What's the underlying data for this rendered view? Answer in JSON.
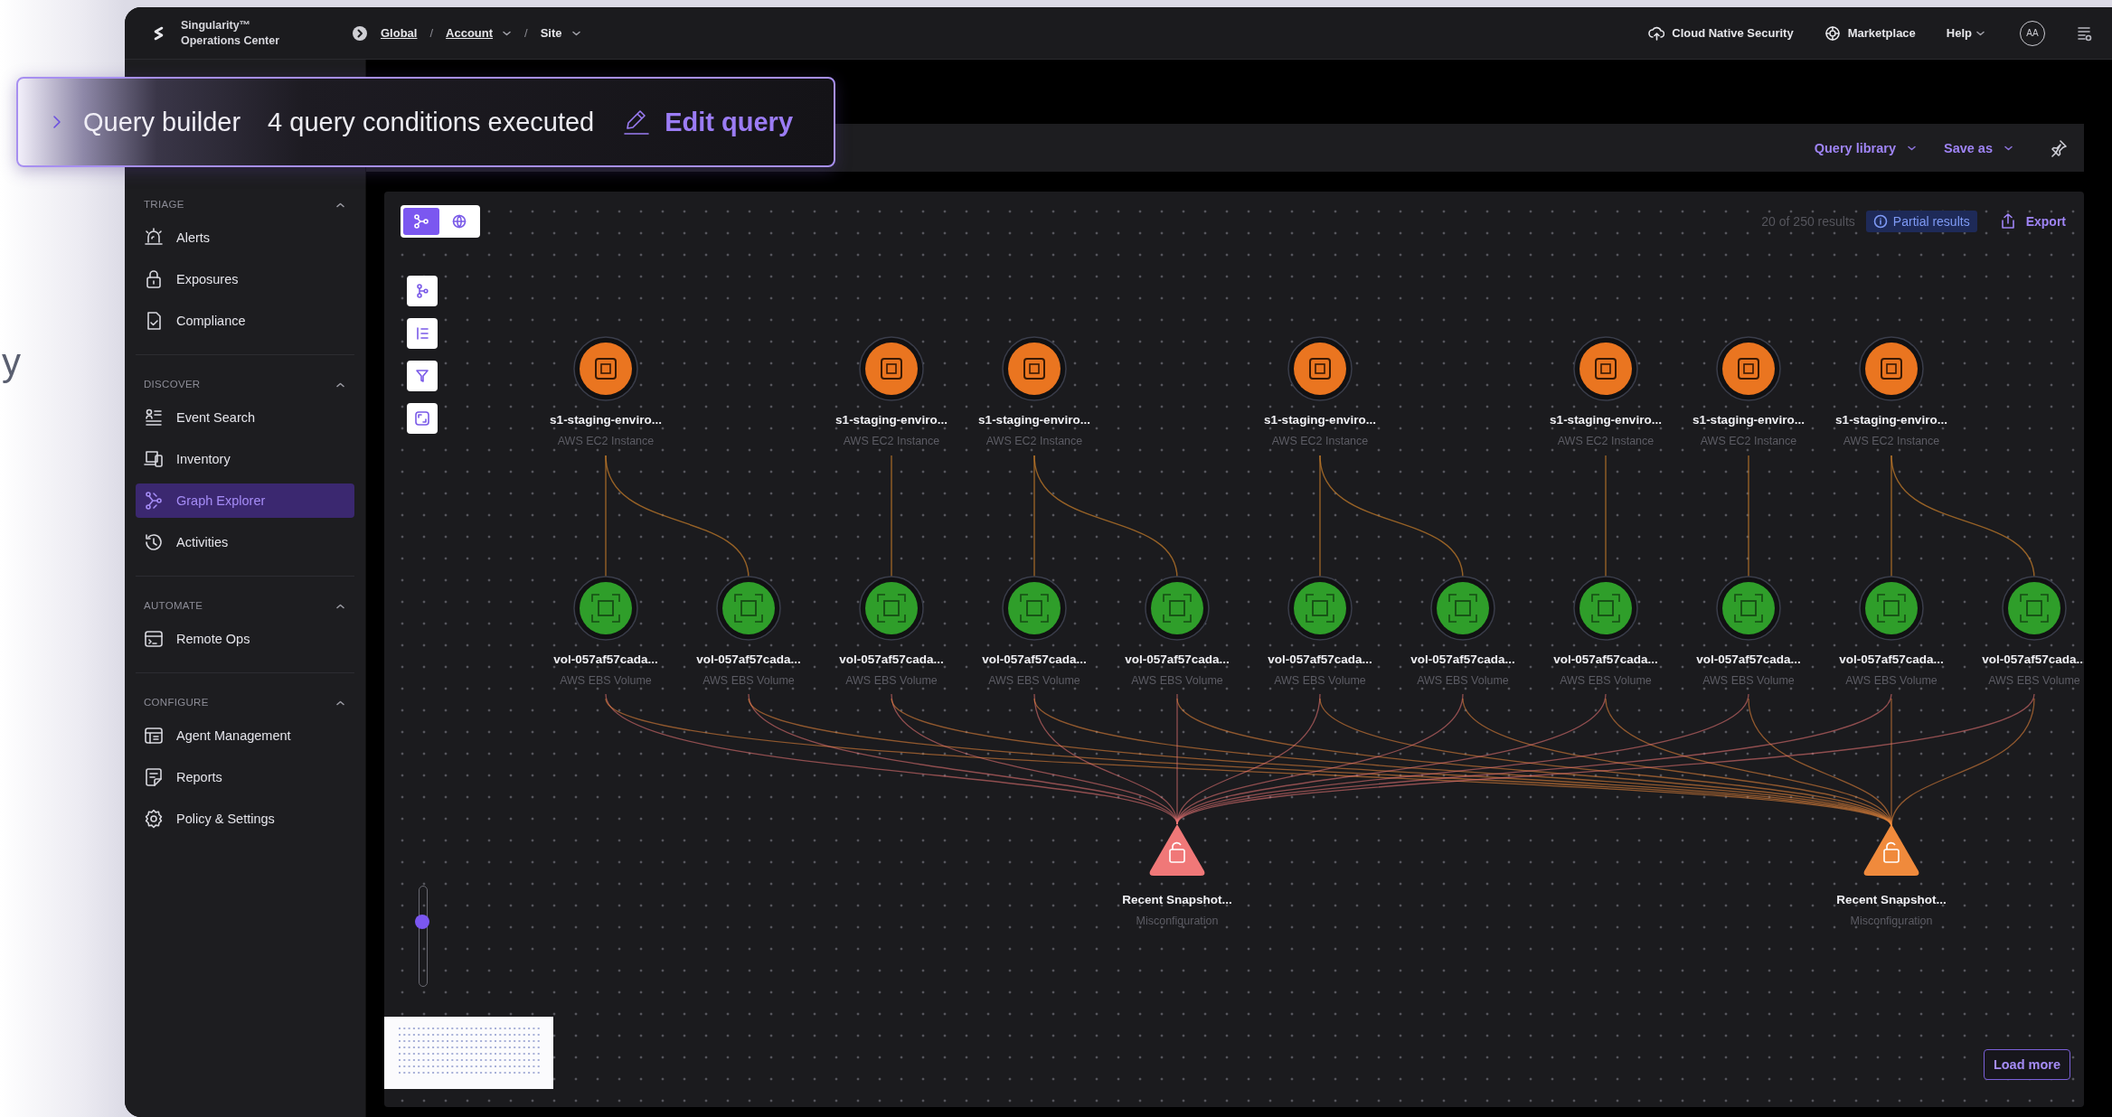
{
  "background_text": "y",
  "top_bar": {
    "product": [
      "Singularity™",
      "Operations Center"
    ],
    "breadcrumb": [
      {
        "kind": "link",
        "text": "Global",
        "dropdown": false
      },
      {
        "kind": "separator",
        "text": "/"
      },
      {
        "kind": "link",
        "text": "Account",
        "dropdown": true
      },
      {
        "kind": "separator",
        "text": "/"
      },
      {
        "kind": "current",
        "text": "Site",
        "dropdown": true
      }
    ],
    "links": [
      {
        "kind": "cloud",
        "label": "Cloud Native Security",
        "dropdown": false
      },
      {
        "kind": "market",
        "label": "Marketplace",
        "dropdown": false
      },
      {
        "kind": "plain",
        "label": "Help",
        "dropdown": true
      }
    ],
    "avatar": "AA"
  },
  "query_builder": {
    "title": "Query builder",
    "summary": "4 query conditions executed",
    "action": "Edit query"
  },
  "toolbar": {
    "query_library": "Query library",
    "save_as": "Save as"
  },
  "sidebar": {
    "sections": [
      {
        "title": "TRIAGE",
        "expanded": true,
        "items": [
          {
            "label": "Alerts",
            "selected": false
          },
          {
            "label": "Exposures",
            "selected": false
          },
          {
            "label": "Compliance",
            "selected": false
          }
        ]
      },
      {
        "title": "DISCOVER",
        "expanded": true,
        "items": [
          {
            "label": "Event Search",
            "selected": false
          },
          {
            "label": "Inventory",
            "selected": false
          },
          {
            "label": "Graph Explorer",
            "selected": true
          },
          {
            "label": "Activities",
            "selected": false
          }
        ]
      },
      {
        "title": "AUTOMATE",
        "expanded": true,
        "items": [
          {
            "label": "Remote Ops",
            "selected": false
          }
        ]
      },
      {
        "title": "CONFIGURE",
        "expanded": true,
        "items": [
          {
            "label": "Agent Management",
            "selected": false
          },
          {
            "label": "Reports",
            "selected": false
          },
          {
            "label": "Policy & Settings",
            "selected": false
          }
        ]
      }
    ]
  },
  "graph": {
    "view_modes": [
      {
        "kind": "graph",
        "selected": true
      },
      {
        "kind": "grid",
        "selected": false
      }
    ],
    "results": "20 of 250 results",
    "partial": "Partial results",
    "export": "Export",
    "zoom": {
      "level": 0.65
    },
    "load_more": "Load more",
    "instances": [
      {
        "name": "s1-staging-enviro...",
        "type": "AWS EC2 Instance",
        "volumes": [
          {
            "name": "vol-057af57cada...",
            "type": "AWS EBS Volume"
          },
          {
            "name": "vol-057af57cada...",
            "type": "AWS EBS Volume"
          }
        ]
      },
      {
        "name": "s1-staging-enviro...",
        "type": "AWS EC2 Instance",
        "volumes": [
          {
            "name": "vol-057af57cada...",
            "type": "AWS EBS Volume"
          }
        ]
      },
      {
        "name": "s1-staging-enviro...",
        "type": "AWS EC2 Instance",
        "volumes": [
          {
            "name": "vol-057af57cada...",
            "type": "AWS EBS Volume"
          },
          {
            "name": "vol-057af57cada...",
            "type": "AWS EBS Volume"
          }
        ]
      },
      {
        "name": "s1-staging-enviro...",
        "type": "AWS EC2 Instance",
        "volumes": [
          {
            "name": "vol-057af57cada...",
            "type": "AWS EBS Volume"
          },
          {
            "name": "vol-057af57cada...",
            "type": "AWS EBS Volume"
          }
        ]
      },
      {
        "name": "s1-staging-enviro...",
        "type": "AWS EC2 Instance",
        "volumes": [
          {
            "name": "vol-057af57cada...",
            "type": "AWS EBS Volume"
          }
        ]
      },
      {
        "name": "s1-staging-enviro...",
        "type": "AWS EC2 Instance",
        "volumes": [
          {
            "name": "vol-057af57cada...",
            "type": "AWS EBS Volume"
          }
        ]
      },
      {
        "name": "s1-staging-enviro...",
        "type": "AWS EC2 Instance",
        "volumes": [
          {
            "name": "vol-057af57cada...",
            "type": "AWS EBS Volume"
          },
          {
            "name": "vol-057af57cada...",
            "type": "AWS EBS Volume"
          }
        ]
      }
    ],
    "findings": [
      {
        "name": "Recent Snapshot...",
        "type": "Misconfiguration",
        "color": "#f07878"
      },
      {
        "name": "Recent Snapshot...",
        "type": "Misconfiguration",
        "color": "#f08a3c"
      }
    ]
  }
}
